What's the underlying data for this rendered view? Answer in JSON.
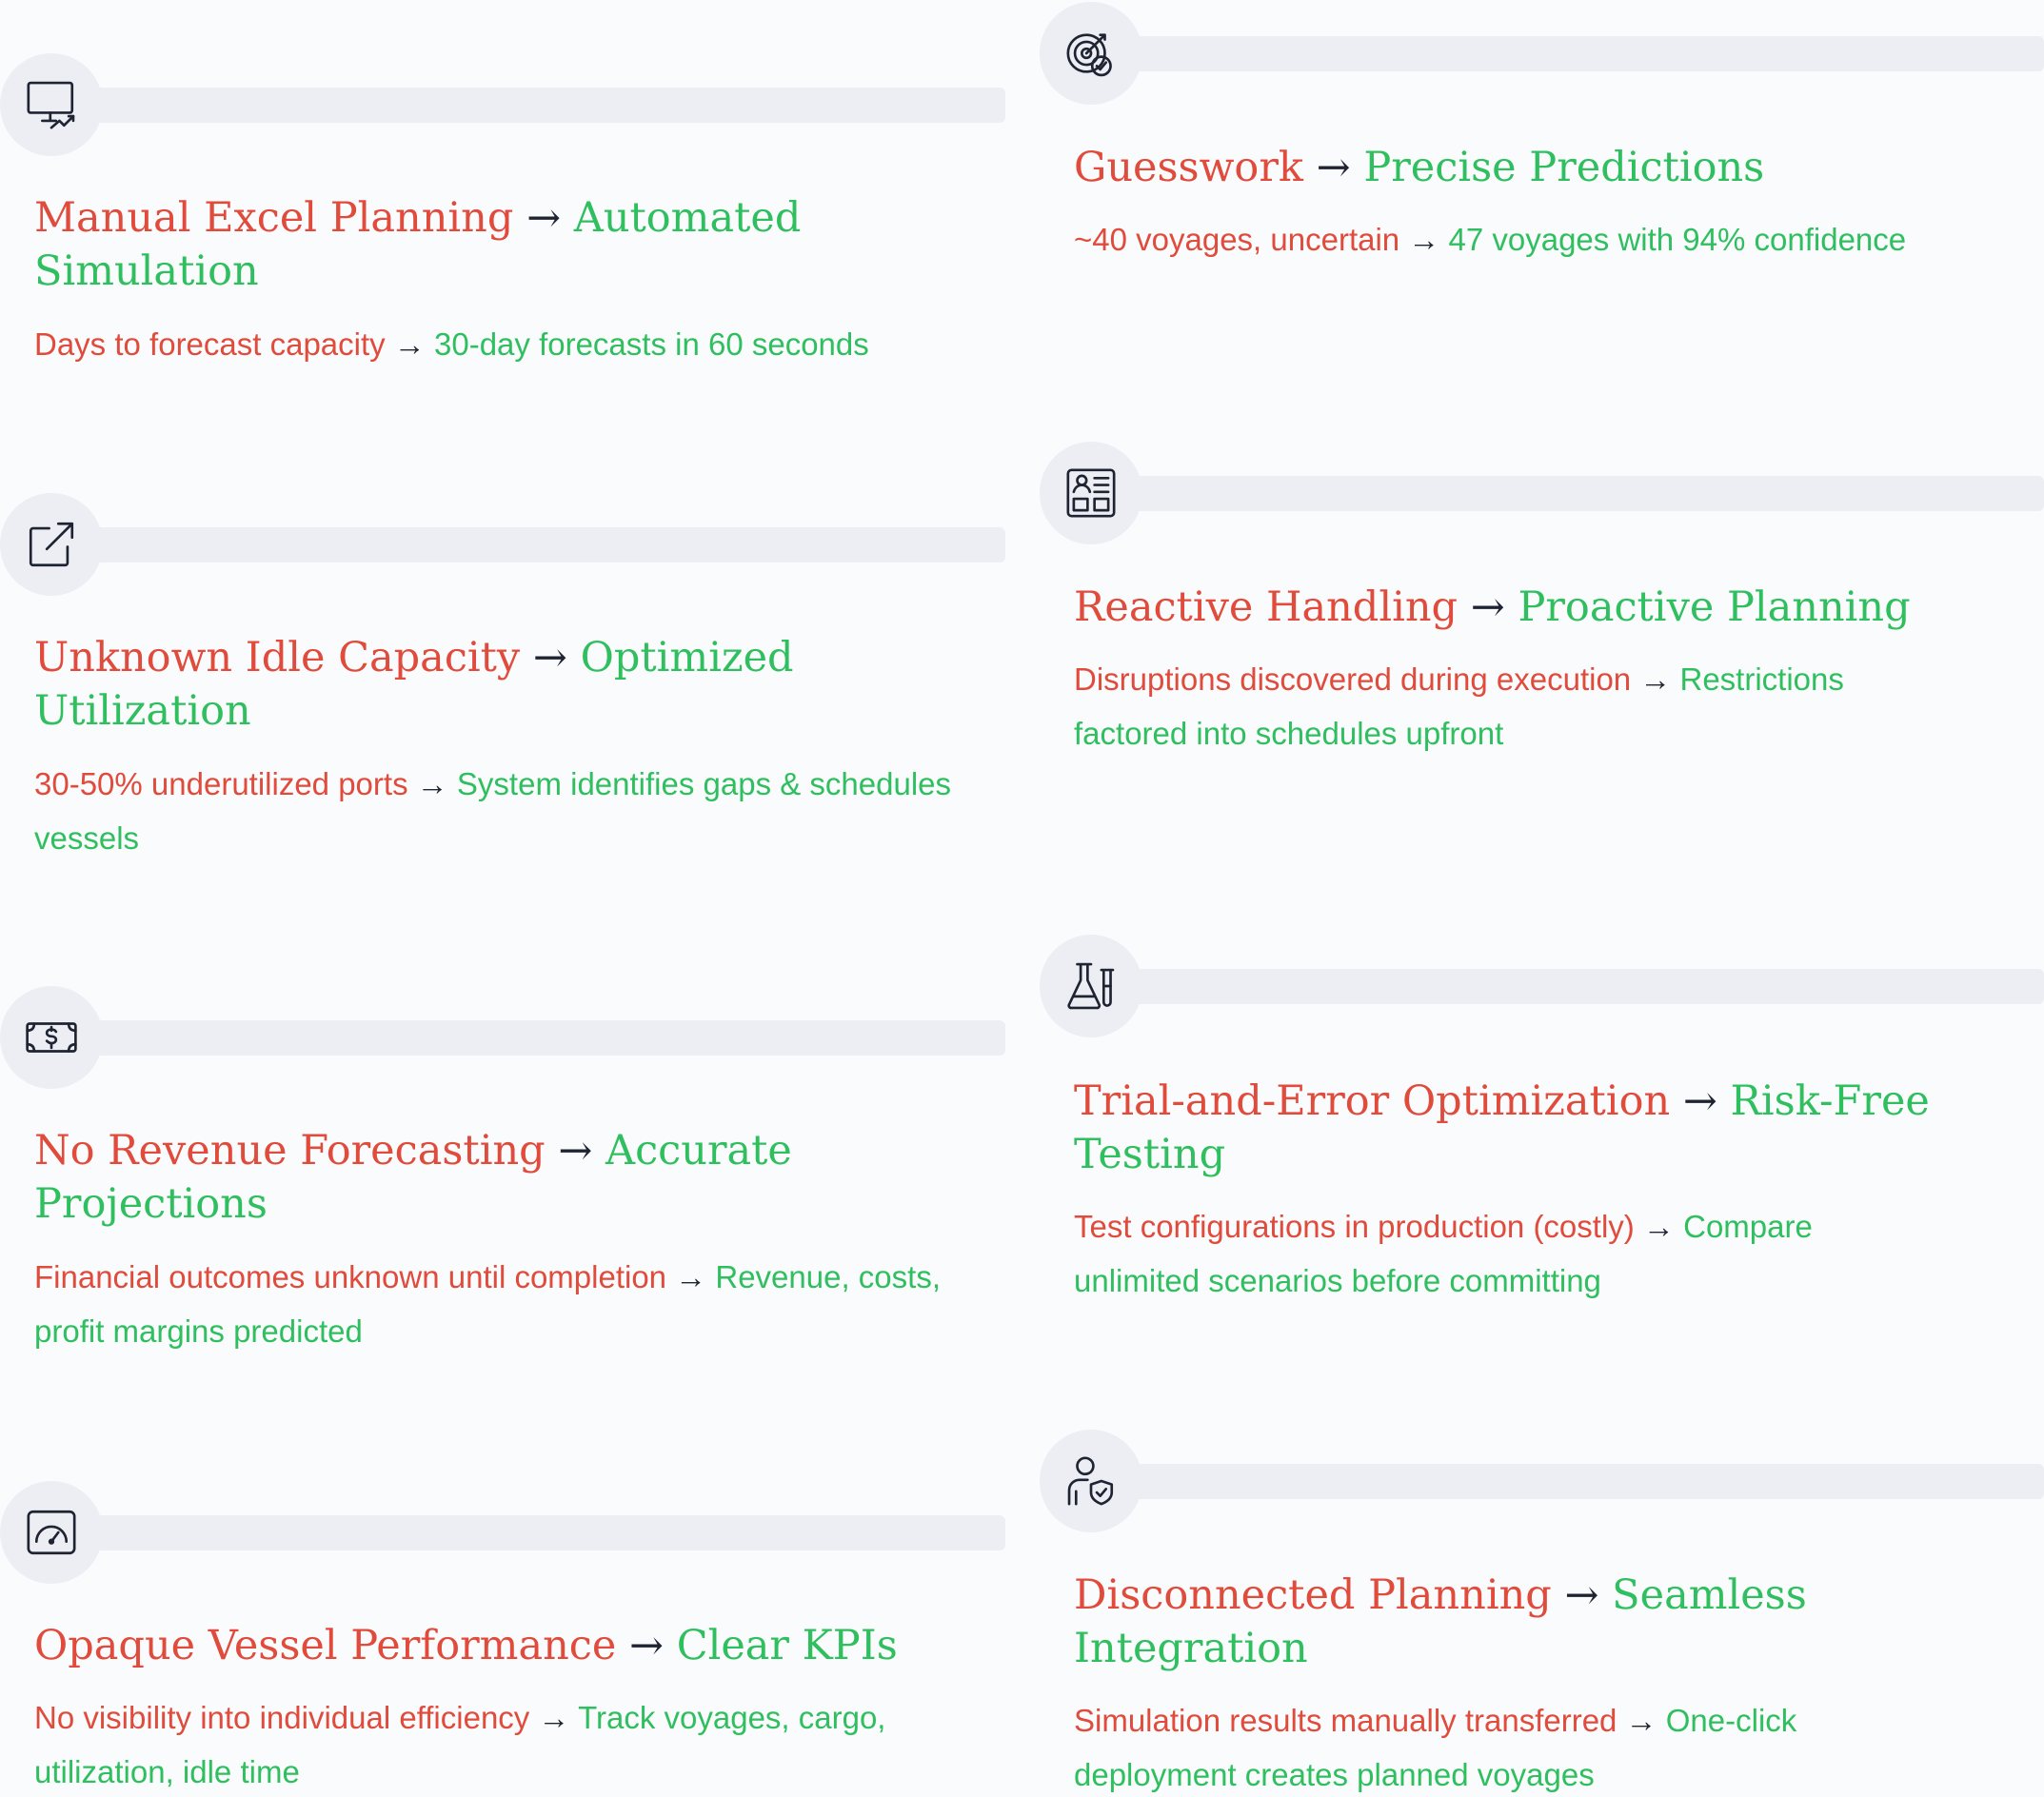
{
  "arrow": "→",
  "cards": [
    {
      "icon": "monitor-chart-icon",
      "title_from": "Manual Excel Planning",
      "title_to": "Automated Simulation",
      "desc_from": "Days to forecast capacity",
      "desc_to": "30-day forecasts in 60 seconds"
    },
    {
      "icon": "target-check-icon",
      "title_from": "Guesswork",
      "title_to": "Precise Predictions",
      "desc_from": "~40 voyages, uncertain",
      "desc_to": "47 voyages with 94% confidence"
    },
    {
      "icon": "external-link-icon",
      "title_from": "Unknown Idle Capacity",
      "title_to": "Optimized Utilization",
      "desc_from": "30-50% underutilized ports",
      "desc_to": "System identifies gaps & schedules vessels"
    },
    {
      "icon": "dashboard-profile-icon",
      "title_from": "Reactive Handling",
      "title_to": "Proactive Planning",
      "desc_from": "Disruptions discovered during execution",
      "desc_to": "Restrictions factored into schedules upfront"
    },
    {
      "icon": "money-bill-icon",
      "title_from": "No Revenue Forecasting",
      "title_to": "Accurate Projections",
      "desc_from": "Financial outcomes unknown until completion",
      "desc_to": "Revenue, costs, profit margins predicted"
    },
    {
      "icon": "flask-icon",
      "title_from": "Trial-and-Error Optimization",
      "title_to": "Risk-Free Testing",
      "desc_from": "Test configurations in production (costly)",
      "desc_to": "Compare unlimited scenarios before committing"
    },
    {
      "icon": "speedometer-icon",
      "title_from": "Opaque Vessel Performance",
      "title_to": "Clear KPIs",
      "desc_from": "No visibility into individual efficiency",
      "desc_to": "Track voyages, cargo, utilization, idle time"
    },
    {
      "icon": "user-shield-icon",
      "title_from": "Disconnected Planning",
      "title_to": "Seamless Integration",
      "desc_from": "Simulation results manually transferred",
      "desc_to": "One-click deployment creates planned voyages"
    }
  ]
}
